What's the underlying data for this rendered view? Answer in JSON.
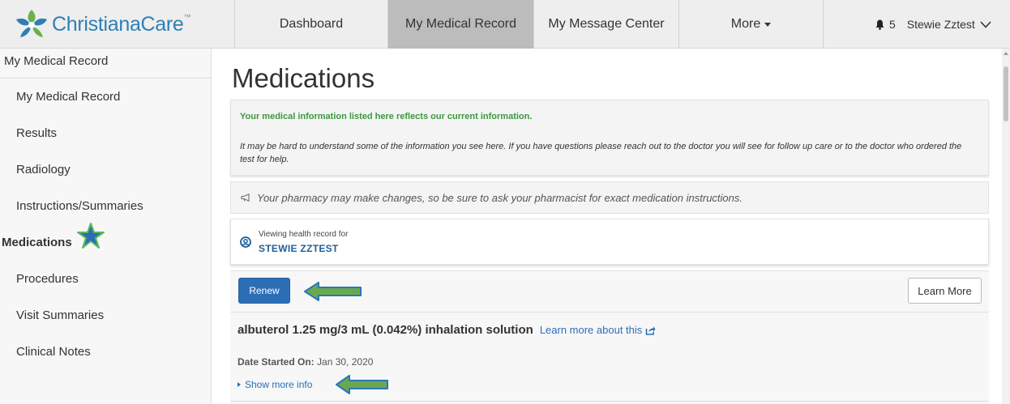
{
  "brand": {
    "name": "ChristianaCare",
    "trademark": "™",
    "colors": {
      "blue": "#2e7fb6",
      "green": "#6ab04c",
      "navy": "#1f5f9a"
    }
  },
  "nav": {
    "tabs": [
      {
        "label": "Dashboard",
        "active": false
      },
      {
        "label": "My Medical Record",
        "active": true
      },
      {
        "label": "My Message Center",
        "active": false
      },
      {
        "label": "More",
        "active": false,
        "dropdown": true
      }
    ]
  },
  "user": {
    "notification_icon": "bell-icon",
    "notification_count": "5",
    "name": "Stewie Zztest",
    "menu_icon": "chevron-down-icon"
  },
  "sidebar": {
    "heading": "My Medical Record",
    "items": [
      {
        "label": "My Medical Record",
        "active": false
      },
      {
        "label": "Results",
        "active": false
      },
      {
        "label": "Radiology",
        "active": false
      },
      {
        "label": "Instructions/Summaries",
        "active": false
      },
      {
        "label": "Medications",
        "active": true,
        "marker": "star-icon"
      },
      {
        "label": "Procedures",
        "active": false
      },
      {
        "label": "Visit Summaries",
        "active": false
      },
      {
        "label": "Clinical Notes",
        "active": false
      }
    ]
  },
  "main": {
    "title": "Medications",
    "info": {
      "headline": "Your medical information listed here reflects our current information.",
      "body": "It may be hard to understand some of the information you see here. If you have questions please reach out to the doctor you will see for follow up care or to the doctor who ordered the test for help."
    },
    "pharmacy_notice": "Your pharmacy may make changes, so be sure to ask your pharmacist for exact medication instructions.",
    "patient": {
      "viewing_label": "Viewing health record for",
      "name": "STEWIE ZZTEST"
    },
    "actions": {
      "renew_label": "Renew",
      "learn_more_label": "Learn More"
    },
    "medication": {
      "name": "albuterol 1.25 mg/3 mL (0.042%) inhalation solution",
      "learn_link": "Learn more about this",
      "date_label": "Date Started On:",
      "date_value": "Jan 30, 2020",
      "show_more": "Show more info"
    }
  }
}
